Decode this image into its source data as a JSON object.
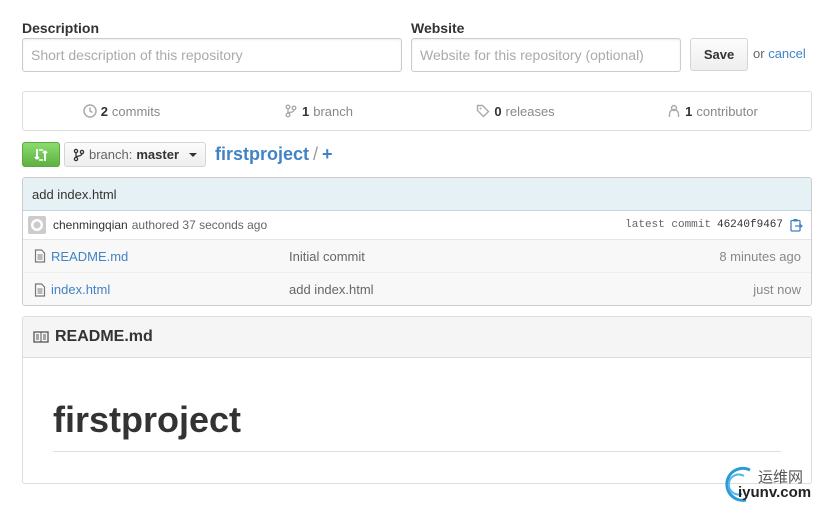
{
  "form": {
    "description_label": "Description",
    "description_placeholder": "Short description of this repository",
    "website_label": "Website",
    "website_placeholder": "Website for this repository (optional)",
    "save_label": "Save",
    "or_text": "or",
    "cancel_label": "cancel"
  },
  "summary": {
    "commits_count": "2",
    "commits_label": "commits",
    "branch_count": "1",
    "branch_label": "branch",
    "releases_count": "0",
    "releases_label": "releases",
    "contributor_count": "1",
    "contributor_label": "contributor"
  },
  "nav": {
    "branch_prefix": "branch:",
    "branch_name": "master",
    "repo_name": "firstproject",
    "separator": "/",
    "add_label": "+"
  },
  "commit": {
    "message": "add index.html",
    "author": "chenmingqian",
    "authored_text": "authored 37 seconds ago",
    "latest_label": "latest commit",
    "sha": "46240f9467"
  },
  "files": [
    {
      "name": "README.md",
      "message": "Initial commit",
      "age": "8 minutes ago"
    },
    {
      "name": "index.html",
      "message": "add index.html",
      "age": "just now"
    }
  ],
  "readme": {
    "header": "README.md",
    "heading": "firstproject"
  },
  "watermark": {
    "cn": "运维网",
    "en": "iyunv.com"
  },
  "colors": {
    "link": "#4183c4",
    "compare_green": "#60b044",
    "commit_bar": "#e6f1f6"
  }
}
